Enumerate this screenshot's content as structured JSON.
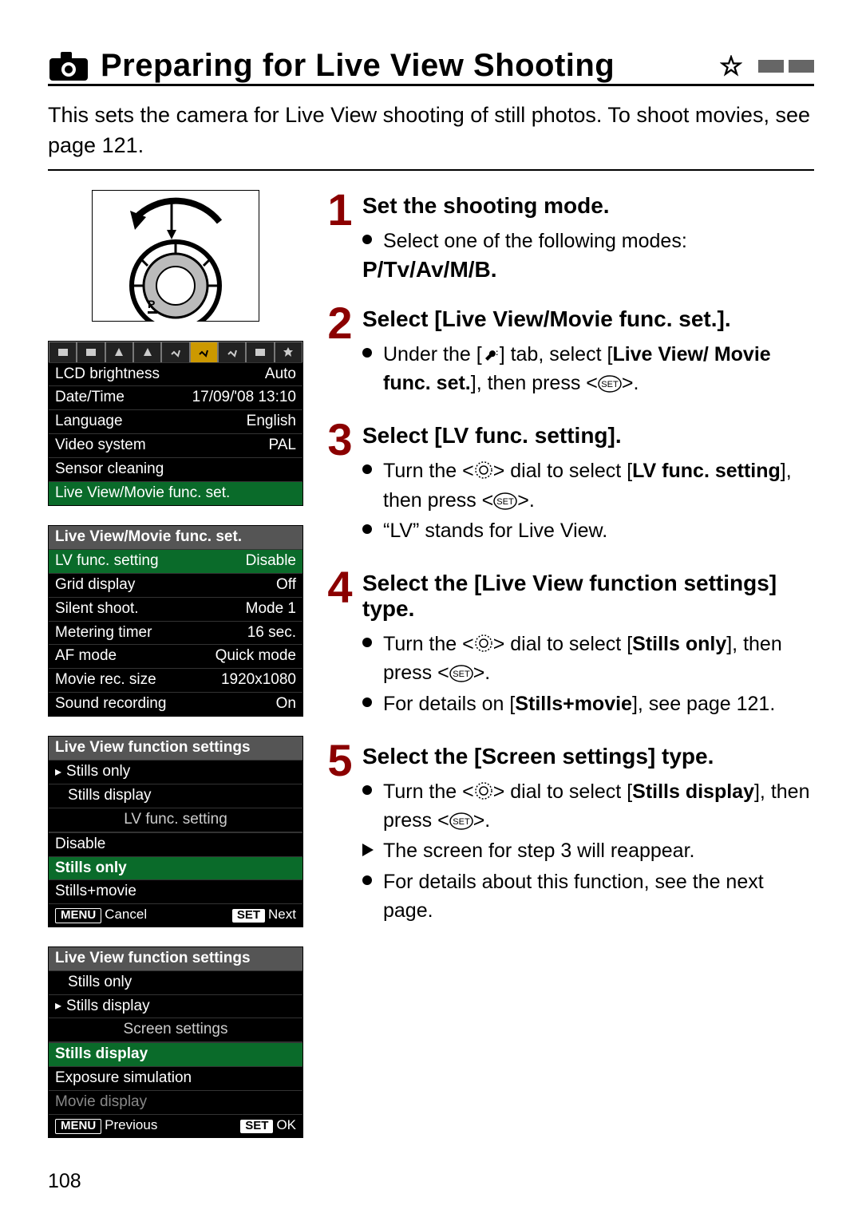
{
  "page": {
    "title": "Preparing for Live View Shooting",
    "intro": "This sets the camera for Live View shooting of still photos. To shoot movies, see page 121.",
    "number": "108"
  },
  "menus": {
    "setup": {
      "rows": [
        {
          "label": "LCD brightness",
          "value": "Auto"
        },
        {
          "label": "Date/Time",
          "value": "17/09/'08 13:10"
        },
        {
          "label": "Language",
          "value": "English"
        },
        {
          "label": "Video system",
          "value": "PAL"
        },
        {
          "label": "Sensor cleaning",
          "value": ""
        },
        {
          "label": "Live View/Movie func. set.",
          "value": "",
          "full": true,
          "active": true
        }
      ]
    },
    "lvfunc": {
      "header": "Live View/Movie func. set.",
      "rows": [
        {
          "label": "LV func. setting",
          "value": "Disable",
          "active": true
        },
        {
          "label": "Grid display",
          "value": "Off"
        },
        {
          "label": "Silent shoot.",
          "value": "Mode 1"
        },
        {
          "label": "Metering timer",
          "value": "16 sec."
        },
        {
          "label": "AF mode",
          "value": "Quick mode"
        },
        {
          "label": "Movie rec. size",
          "value": "1920x1080"
        },
        {
          "label": "Sound recording",
          "value": "On"
        }
      ]
    },
    "lvfs1": {
      "header": "Live View function settings",
      "items": [
        {
          "label": "Stills only",
          "pointer": true
        },
        {
          "label": "Stills display",
          "indent": true
        }
      ],
      "subhead": "LV func. setting",
      "options": [
        {
          "label": "Disable"
        },
        {
          "label": "Stills only",
          "highlight": true
        },
        {
          "label": "Stills+movie"
        }
      ],
      "footer": {
        "leftBtn": "MENU",
        "leftLabel": "Cancel",
        "rightBtn": "SET",
        "rightLabel": "Next"
      }
    },
    "lvfs2": {
      "header": "Live View function settings",
      "items": [
        {
          "label": "Stills only",
          "indent": true
        },
        {
          "label": "Stills display",
          "pointer": true
        }
      ],
      "subhead": "Screen settings",
      "options": [
        {
          "label": "Stills display",
          "highlight": true
        },
        {
          "label": "Exposure simulation"
        },
        {
          "label": "Movie display",
          "dim": true
        }
      ],
      "footer": {
        "leftBtn": "MENU",
        "leftLabel": "Previous",
        "rightBtn": "SET",
        "rightLabel": "OK"
      }
    }
  },
  "steps": [
    {
      "num": "1",
      "heading": "Set the shooting mode.",
      "bullets": [
        {
          "text": "Select one of the following modes:"
        }
      ],
      "modes": "P/Tv/Av/M/B"
    },
    {
      "num": "2",
      "heading": "Select [Live View/Movie func. set.].",
      "bullets": [
        {
          "rich": "under_tab"
        }
      ]
    },
    {
      "num": "3",
      "heading": "Select [LV func. setting].",
      "bullets": [
        {
          "rich": "turn_lvfunc"
        },
        {
          "text": "“LV” stands for Live View."
        }
      ]
    },
    {
      "num": "4",
      "heading": "Select the [Live View function settings] type.",
      "bullets": [
        {
          "rich": "turn_stills_only"
        },
        {
          "rich": "stills_movie_detail"
        }
      ]
    },
    {
      "num": "5",
      "heading": "Select the [Screen settings] type.",
      "bullets": [
        {
          "rich": "turn_stills_display"
        },
        {
          "tri": true,
          "text": "The screen for step 3 will reappear."
        },
        {
          "text": "For details about this function, see the next page."
        }
      ]
    }
  ],
  "strings": {
    "under_tab_pre": "Under the [",
    "under_tab_mid": "] tab, select [",
    "under_tab_b1": "Live View/ Movie func. set.",
    "under_tab_post": "], then press <",
    "under_tab_end": ">.",
    "turn_pre": "Turn the <",
    "turn_mid": "> dial to select [",
    "b_lvfunc": "LV func. setting",
    "turn_post": "], then press <",
    "turn_end": ">.",
    "b_stills_only": "Stills only",
    "stills_movie_detail_a": "For details on [",
    "stills_movie_detail_b": "Stills+movie",
    "stills_movie_detail_c": "], see page 121.",
    "b_stills_display": "Stills display"
  }
}
